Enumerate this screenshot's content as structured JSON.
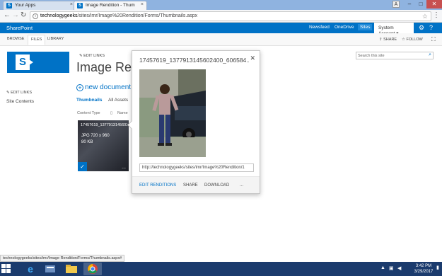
{
  "browser": {
    "tabs": [
      {
        "title": "Your Apps",
        "active": false
      },
      {
        "title": "Image Rendition - Thum",
        "active": true
      }
    ],
    "user_initial": "A",
    "url_host": "technologygeeks",
    "url_path": "/sites/imr/Image%20Rendition/Forms/Thumbnails.aspx",
    "status_url": "technologygeeks/sites/imr/Image Rendition/Forms/Thumbnails.aspx#"
  },
  "suitebar": {
    "brand": "SharePoint",
    "links": [
      "Newsfeed",
      "OneDrive",
      "Sites"
    ],
    "account": "System Account ▾"
  },
  "ribbon": {
    "tabs": [
      "BROWSE",
      "FILES",
      "LIBRARY"
    ],
    "share_label": "SHARE",
    "follow_label": "FOLLOW"
  },
  "page": {
    "edit_links_top": "EDIT LINKS",
    "edit_links_left": "EDIT LINKS",
    "site_contents": "Site Contents",
    "title": "Image Rendition",
    "new_document": "new document or drag files here",
    "views": [
      "Thumbnails",
      "All Assets"
    ],
    "columns": [
      "Content Type",
      "Name"
    ],
    "search_placeholder": "Search this site"
  },
  "thumbnail": {
    "name": "17457619_1377913145602400_606584",
    "dimensions": "JPG 720 x 960",
    "size": "80 KB",
    "more": "..."
  },
  "callout": {
    "title": "17457619_1377913145602400_606584...",
    "url": "http://technologygeeks/sites/imr/Image%20Rendition/1",
    "actions": [
      "EDIT RENDITIONS",
      "SHARE",
      "DOWNLOAD",
      "..."
    ]
  },
  "taskbar": {
    "time": "3:42 PM",
    "date": "3/29/2017"
  },
  "colors": {
    "brand": "#0072c6",
    "taskbar": "#1b3b6d"
  }
}
